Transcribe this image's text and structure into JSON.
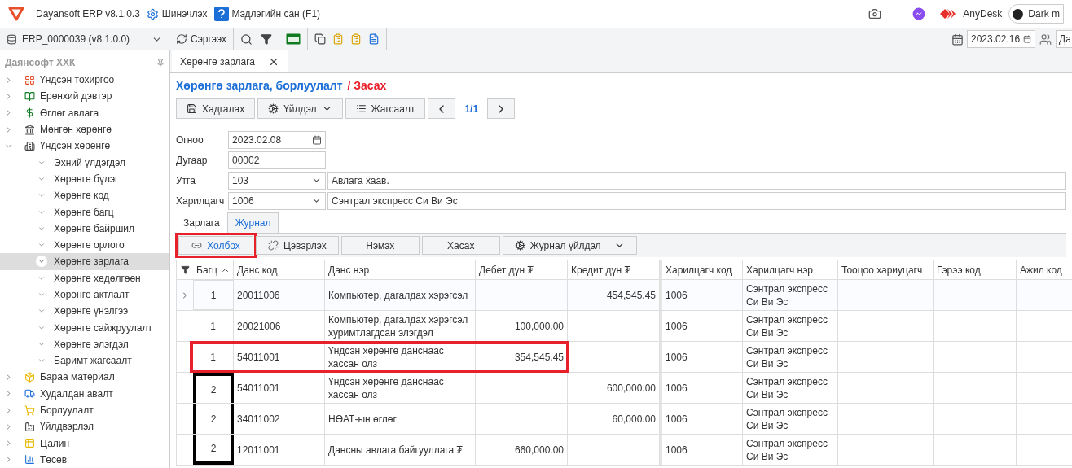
{
  "app": {
    "title": "Dayansoft ERP v8.1.0.3",
    "links": [
      {
        "label": "Шинэчлэх",
        "kind": "gear"
      },
      {
        "label": "Мэдлэгийн сан (F1)",
        "kind": "help"
      }
    ],
    "remote": "AnyDesk",
    "dark_mode": {
      "label": "Dark m",
      "on": false
    }
  },
  "toolbar": {
    "database": "ERP_0000039 (v8.1.0.0)",
    "refresh": "Сэргээх",
    "date": "2023.02.16",
    "user": "Да"
  },
  "sidebar": {
    "company": "Даянсофт ХХК",
    "items": [
      {
        "label": "Үндсэн тохиргоо",
        "expanded": false,
        "selected": false
      },
      {
        "label": "Ерөнхий дэвтэр",
        "expanded": false,
        "selected": false
      },
      {
        "label": "Өглөг авлага",
        "expanded": false,
        "selected": false
      },
      {
        "label": "Мөнгөн хөрөнгө",
        "expanded": false,
        "selected": false
      },
      {
        "label": "Үндсэн хөрөнгө",
        "expanded": true,
        "selected": false,
        "children": [
          {
            "label": "Эхний үлдэгдэл",
            "selected": false
          },
          {
            "label": "Хөрөнгө бүлэг",
            "selected": false
          },
          {
            "label": "Хөрөнгө код",
            "selected": false
          },
          {
            "label": "Хөрөнгө багц",
            "selected": false
          },
          {
            "label": "Хөрөнгө байршил",
            "selected": false
          },
          {
            "label": "Хөрөнгө орлого",
            "selected": false
          },
          {
            "label": "Хөрөнгө зарлага",
            "selected": true
          },
          {
            "label": "Хөрөнгө хөдөлгөөн",
            "selected": false
          },
          {
            "label": "Хөрөнгө актлалт",
            "selected": false
          },
          {
            "label": "Хөрөнгө үнэлгээ",
            "selected": false
          },
          {
            "label": "Хөрөнгө сайжруулалт",
            "selected": false
          },
          {
            "label": "Хөрөнгө элэгдэл",
            "selected": false
          },
          {
            "label": "Баримт жагсаалт",
            "selected": false
          }
        ]
      },
      {
        "label": "Бараа материал",
        "expanded": false,
        "selected": false
      },
      {
        "label": "Худалдан авалт",
        "expanded": false,
        "selected": false
      },
      {
        "label": "Борлуулалт",
        "expanded": false,
        "selected": false
      },
      {
        "label": "Үйлдвэрлэл",
        "expanded": false,
        "selected": false
      },
      {
        "label": "Цалин",
        "expanded": false,
        "selected": false
      },
      {
        "label": "Төсөв",
        "expanded": false,
        "selected": false
      }
    ]
  },
  "document_tabs": [
    {
      "label": "Хөрөнгө зарлага",
      "selected": true
    }
  ],
  "form": {
    "title": "Хөрөнгө зарлага, борлуулалт",
    "mode": "/ Засах",
    "buttons": [
      {
        "label": "Хадгалах",
        "kind": "save"
      },
      {
        "label": "Үйлдэл",
        "kind": "menu"
      },
      {
        "label": "Жагсаалт",
        "kind": "list"
      }
    ],
    "pager": "1/1",
    "fields": [
      {
        "label": "Огноо",
        "value": "2023.02.08",
        "kind": "date"
      },
      {
        "label": "Дугаар",
        "value": "00002",
        "kind": "text"
      },
      {
        "label": "Утга",
        "value": "103",
        "kind": "select",
        "description": "Авлага хаав."
      },
      {
        "label": "Харилцагч",
        "value": "1006",
        "kind": "select",
        "description": "Сэнтрал экспресс Си Ви Эс"
      }
    ]
  },
  "sub_tabs": [
    {
      "label": "Зарлага",
      "selected": false
    },
    {
      "label": "Журнал",
      "selected": true
    }
  ],
  "journal_toolbar": [
    {
      "label": "Холбох",
      "kind": "link",
      "framed": true
    },
    {
      "label": "Цэвэрлэх",
      "kind": "unlink",
      "framed": false
    },
    {
      "label": "Нэмэх",
      "kind": "plain",
      "framed": false
    },
    {
      "label": "Хасах",
      "kind": "plain",
      "framed": false
    },
    {
      "label": "Журнал үйлдэл",
      "kind": "menu",
      "framed": false
    }
  ],
  "grid": {
    "columns": [
      {
        "label": "Багц",
        "sorted": true
      },
      {
        "label": "Данс код",
        "sorted": false
      },
      {
        "label": "Данс нэр",
        "sorted": false
      },
      {
        "label": "Дебет дүн ₮",
        "sorted": false
      },
      {
        "label": "Кредит дүн ₮",
        "sorted": false
      },
      {
        "label": "Харилцагч код",
        "sorted": false
      },
      {
        "label": "Харилцагч нэр",
        "sorted": false
      },
      {
        "label": "Тооцоо хариуцагч",
        "sorted": false
      },
      {
        "label": "Гэрээ код",
        "sorted": false
      },
      {
        "label": "Ажил код",
        "sorted": false
      }
    ],
    "rows": [
      {
        "current": true,
        "framed": false,
        "batch_framed": false,
        "batch": "1",
        "account_code": "20011006",
        "account_name": "Компьютер, дагалдах хэрэгсэл",
        "credit": "454,545.45",
        "partner_code": "1006",
        "partner_name": "Сэнтрал экспресс Си Ви Эс"
      },
      {
        "current": false,
        "framed": false,
        "batch_framed": false,
        "batch": "1",
        "account_code": "20021006",
        "account_name": "Компьютер, дагалдах хэрэгсэл хуримтлагдсан элэгдэл",
        "debit": "100,000.00",
        "partner_code": "1006",
        "partner_name": "Сэнтрал экспресс Си Ви Эс"
      },
      {
        "current": false,
        "framed": true,
        "batch_framed": false,
        "batch": "1",
        "account_code": "54011001",
        "account_name": "Үндсэн хөрөнгө данснаас хассан олз",
        "debit": "354,545.45",
        "partner_code": "1006",
        "partner_name": "Сэнтрал экспресс Си Ви Эс"
      },
      {
        "current": false,
        "batch_framed": true,
        "batch": "2",
        "account_code": "54011001",
        "account_name": "Үндсэн хөрөнгө данснаас хассан олз",
        "credit": "600,000.00",
        "partner_code": "1006",
        "partner_name": "Сэнтрал экспресс Си Ви Эс"
      },
      {
        "current": false,
        "batch_framed": true,
        "batch": "2",
        "account_code": "34011002",
        "account_name": "НӨАТ-ын өглөг",
        "credit": "60,000.00",
        "partner_code": "1006",
        "partner_name": "Сэнтрал экспресс Си Ви Эс"
      },
      {
        "current": false,
        "batch_framed": true,
        "batch": "2",
        "account_code": "12011001",
        "account_name": "Дансны авлага байгууллага ₮",
        "debit": "660,000.00",
        "partner_code": "1006",
        "partner_name": "Сэнтрал экспресс Си Ви Эс"
      }
    ]
  }
}
